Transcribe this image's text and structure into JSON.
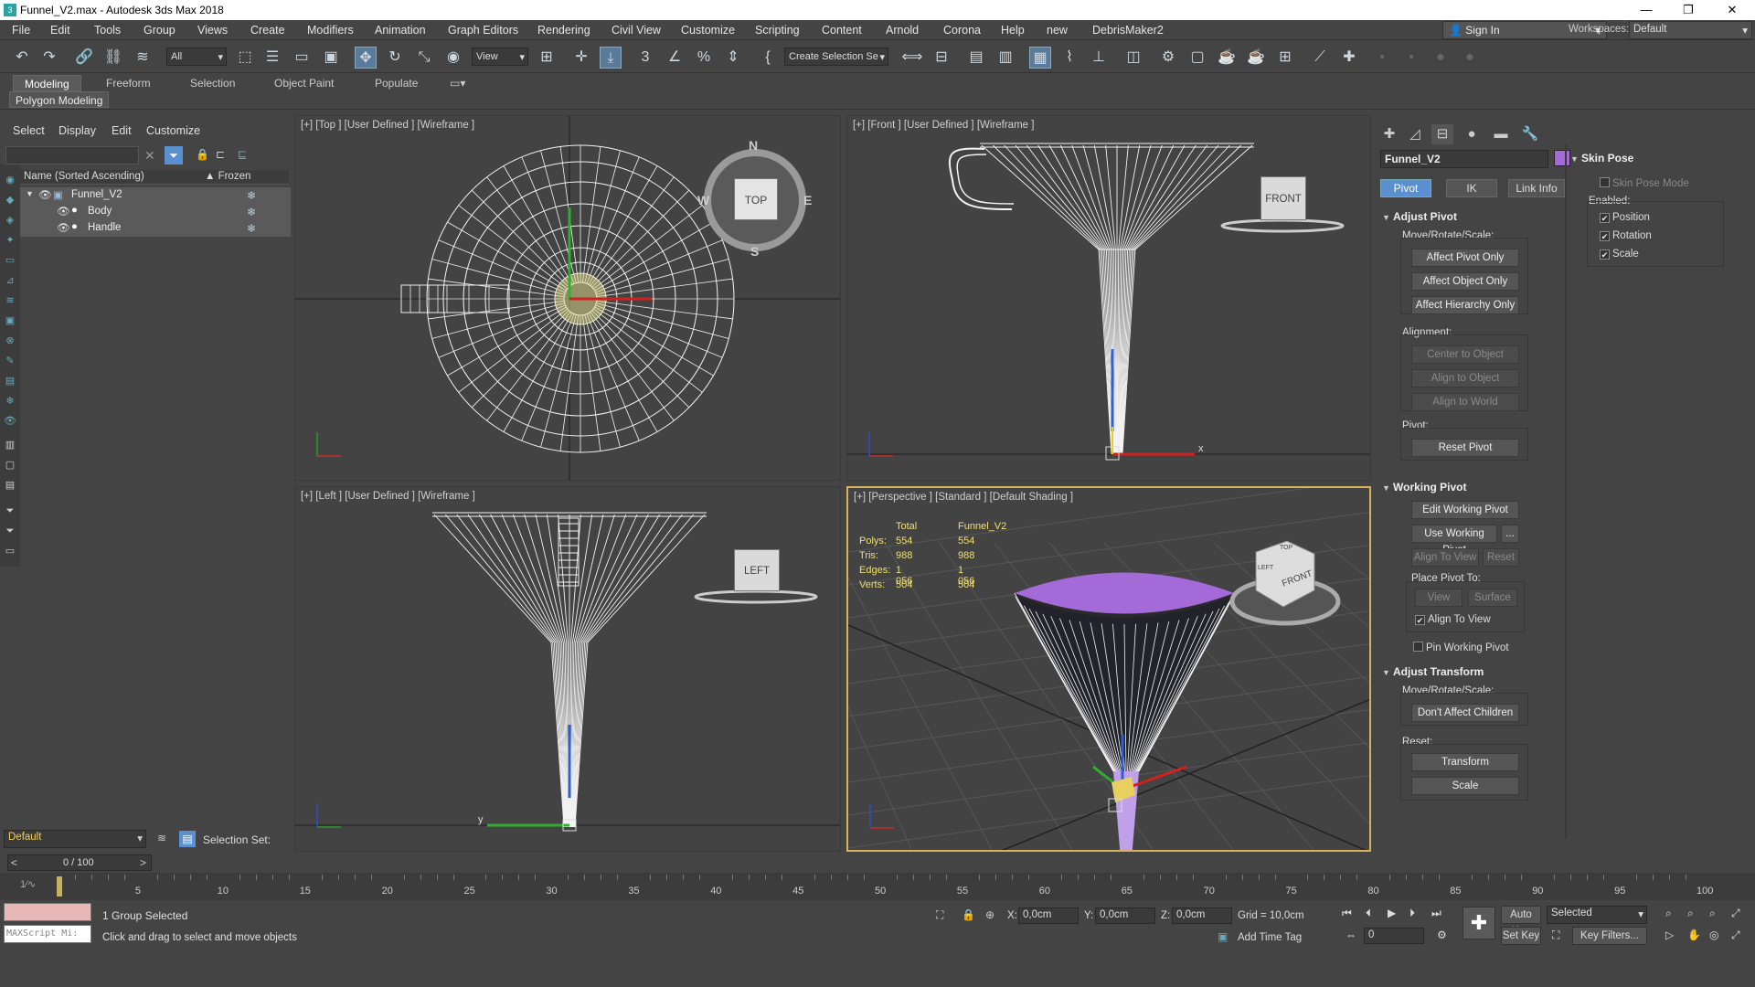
{
  "window": {
    "title": "Funnel_V2.max - Autodesk 3ds Max 2018"
  },
  "menu": [
    "File",
    "Edit",
    "Tools",
    "Group",
    "Views",
    "Create",
    "Modifiers",
    "Animation",
    "Graph Editors",
    "Rendering",
    "Civil View",
    "Customize",
    "Scripting",
    "Content",
    "Arnold",
    "Corona",
    "Help",
    "new",
    "DebrisMaker2"
  ],
  "account": {
    "sign_in": "Sign In",
    "workspaces_label": "Workspaces:",
    "workspace": "Default"
  },
  "toolbar": {
    "filter": "All",
    "ref_coord": "View",
    "selection_set": "Create Selection Se"
  },
  "ribbon": {
    "tabs": [
      "Modeling",
      "Freeform",
      "Selection",
      "Object Paint",
      "Populate"
    ],
    "active_tab": "Modeling",
    "panel": "Polygon Modeling"
  },
  "scene_explorer": {
    "menu": [
      "Select",
      "Display",
      "Edit",
      "Customize"
    ],
    "col_name": "Name (Sorted Ascending)",
    "col_frozen": "▲ Frozen",
    "rows": [
      "Funnel_V2",
      "Body",
      "Handle"
    ],
    "layer": "Default",
    "selection_set_label": "Selection Set:"
  },
  "viewports": {
    "top": "[+] [Top ] [User Defined ] [Wireframe ]",
    "front": "[+] [Front ] [User Defined ] [Wireframe ]",
    "left": "[+] [Left ] [User Defined ] [Wireframe ]",
    "persp": "[+] [Perspective ] [Standard ] [Default Shading ]",
    "cube_top": "TOP",
    "cube_front": "FRONT",
    "cube_left": "LEFT",
    "compass_n": "N",
    "compass_s": "S",
    "compass_e": "E",
    "compass_w": "W",
    "axis_x": "x",
    "axis_y": "y",
    "persp_cube_front": "FRONT",
    "persp_cube_top": "TOP",
    "persp_cube_left": "LEFT"
  },
  "stats": {
    "col_total": "Total",
    "col_object": "Funnel_V2",
    "rows": [
      {
        "label": "Polys:",
        "total": "554",
        "obj": "554"
      },
      {
        "label": "Tris:",
        "total": "988",
        "obj": "988"
      },
      {
        "label": "Edges:",
        "total": "1 056",
        "obj": "1 056"
      },
      {
        "label": "Verts:",
        "total": "504",
        "obj": "504"
      }
    ]
  },
  "command_panel": {
    "object_name": "Funnel_V2",
    "color": "#a36ad8",
    "subtabs": [
      "Pivot",
      "IK",
      "Link Info"
    ],
    "adjust_pivot": {
      "title": "Adjust Pivot",
      "move_label": "Move/Rotate/Scale:",
      "buttons": [
        "Affect Pivot Only",
        "Affect Object Only",
        "Affect Hierarchy Only"
      ],
      "alignment_label": "Alignment:",
      "align_buttons": [
        "Center to Object",
        "Align to Object",
        "Align to World"
      ],
      "pivot_label": "Pivot:",
      "reset_pivot": "Reset Pivot"
    },
    "working_pivot": {
      "title": "Working Pivot",
      "edit": "Edit Working Pivot",
      "use": "Use Working Pivot",
      "more": "...",
      "align_to_view": "Align To View",
      "reset": "Reset",
      "place_label": "Place Pivot To:",
      "view": "View",
      "surface": "Surface",
      "align_check": "Align To View",
      "pin": "Pin Working Pivot"
    },
    "adjust_transform": {
      "title": "Adjust Transform",
      "move_label": "Move/Rotate/Scale:",
      "dont_affect": "Don't Affect Children",
      "reset_label": "Reset:",
      "transform": "Transform",
      "scale": "Scale"
    }
  },
  "skin_pose": {
    "title": "Skin Pose",
    "mode": "Skin Pose Mode",
    "enabled_label": "Enabled:",
    "position": "Position",
    "rotation": "Rotation",
    "scale": "Scale"
  },
  "timeline": {
    "frame": "0 / 100",
    "ticks": [
      "5",
      "10",
      "15",
      "20",
      "25",
      "30",
      "35",
      "40",
      "45",
      "50",
      "55",
      "60",
      "65",
      "70",
      "75",
      "80",
      "85",
      "90",
      "95",
      "100"
    ]
  },
  "status": {
    "selected": "1 Group Selected",
    "prompt": "Click and drag to select and move objects",
    "maxscript": "MAXScript Mi:",
    "x_label": "X:",
    "x": "0,0cm",
    "y_label": "Y:",
    "y": "0,0cm",
    "z_label": "Z:",
    "z": "0,0cm",
    "grid": "Grid = 10,0cm",
    "add_time_tag": "Add Time Tag",
    "auto_key": "Auto Key",
    "set_key": "Set Key",
    "selected_drop": "Selected",
    "key_filters": "Key Filters...",
    "current_frame": "0"
  }
}
